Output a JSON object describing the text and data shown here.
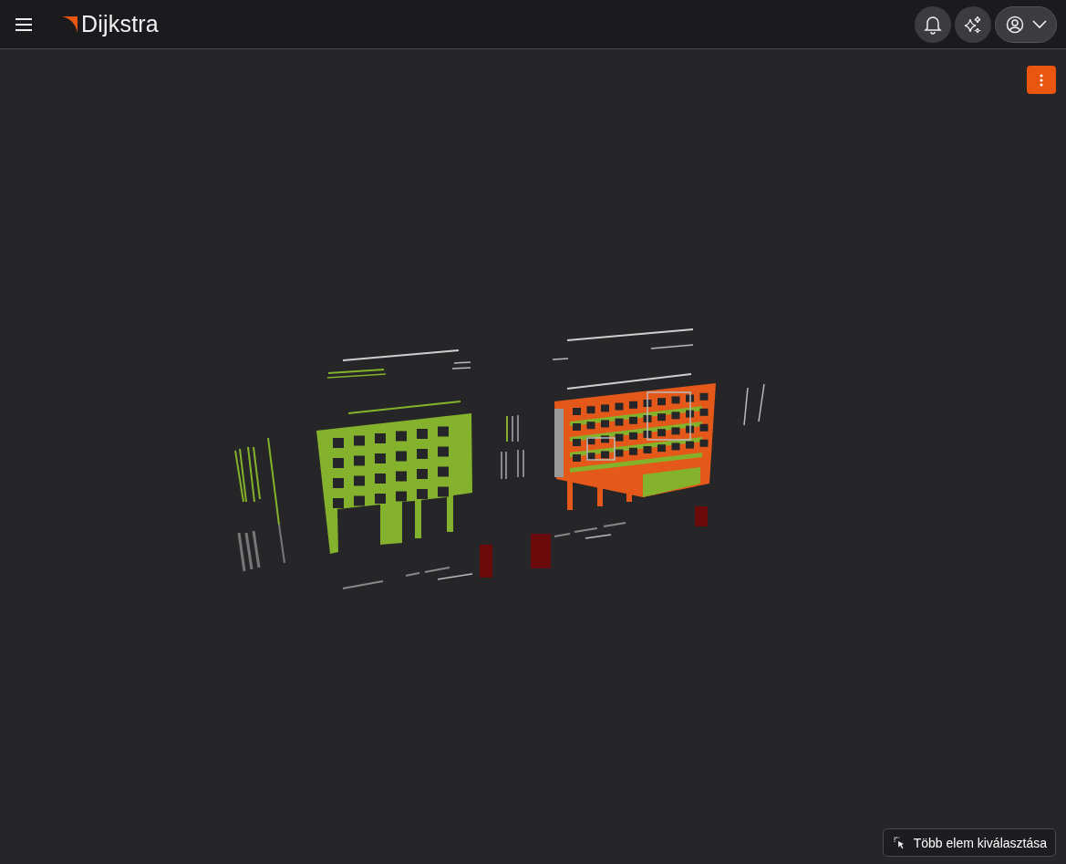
{
  "app": {
    "name": "Dijkstra"
  },
  "multi_select_button": {
    "label": "Több elem kiválasztása"
  }
}
